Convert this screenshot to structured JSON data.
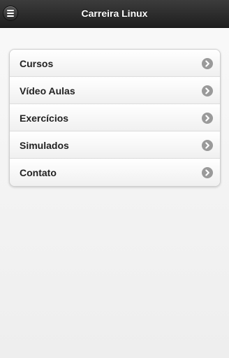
{
  "header": {
    "title": "Carreira Linux",
    "menu_icon": "hamburger-menu-icon"
  },
  "menu": {
    "items": [
      {
        "label": "Cursos",
        "icon": "chevron-right-circle-icon"
      },
      {
        "label": "Vídeo Aulas",
        "icon": "chevron-right-circle-icon"
      },
      {
        "label": "Exercícios",
        "icon": "chevron-right-circle-icon"
      },
      {
        "label": "Simulados",
        "icon": "chevron-right-circle-icon"
      },
      {
        "label": "Contato",
        "icon": "chevron-right-circle-icon"
      }
    ]
  },
  "colors": {
    "header_bg": "#2a2a2a",
    "title_text": "#ffffff",
    "item_text": "#222222",
    "chevron_bg": "#9a9a9a"
  }
}
